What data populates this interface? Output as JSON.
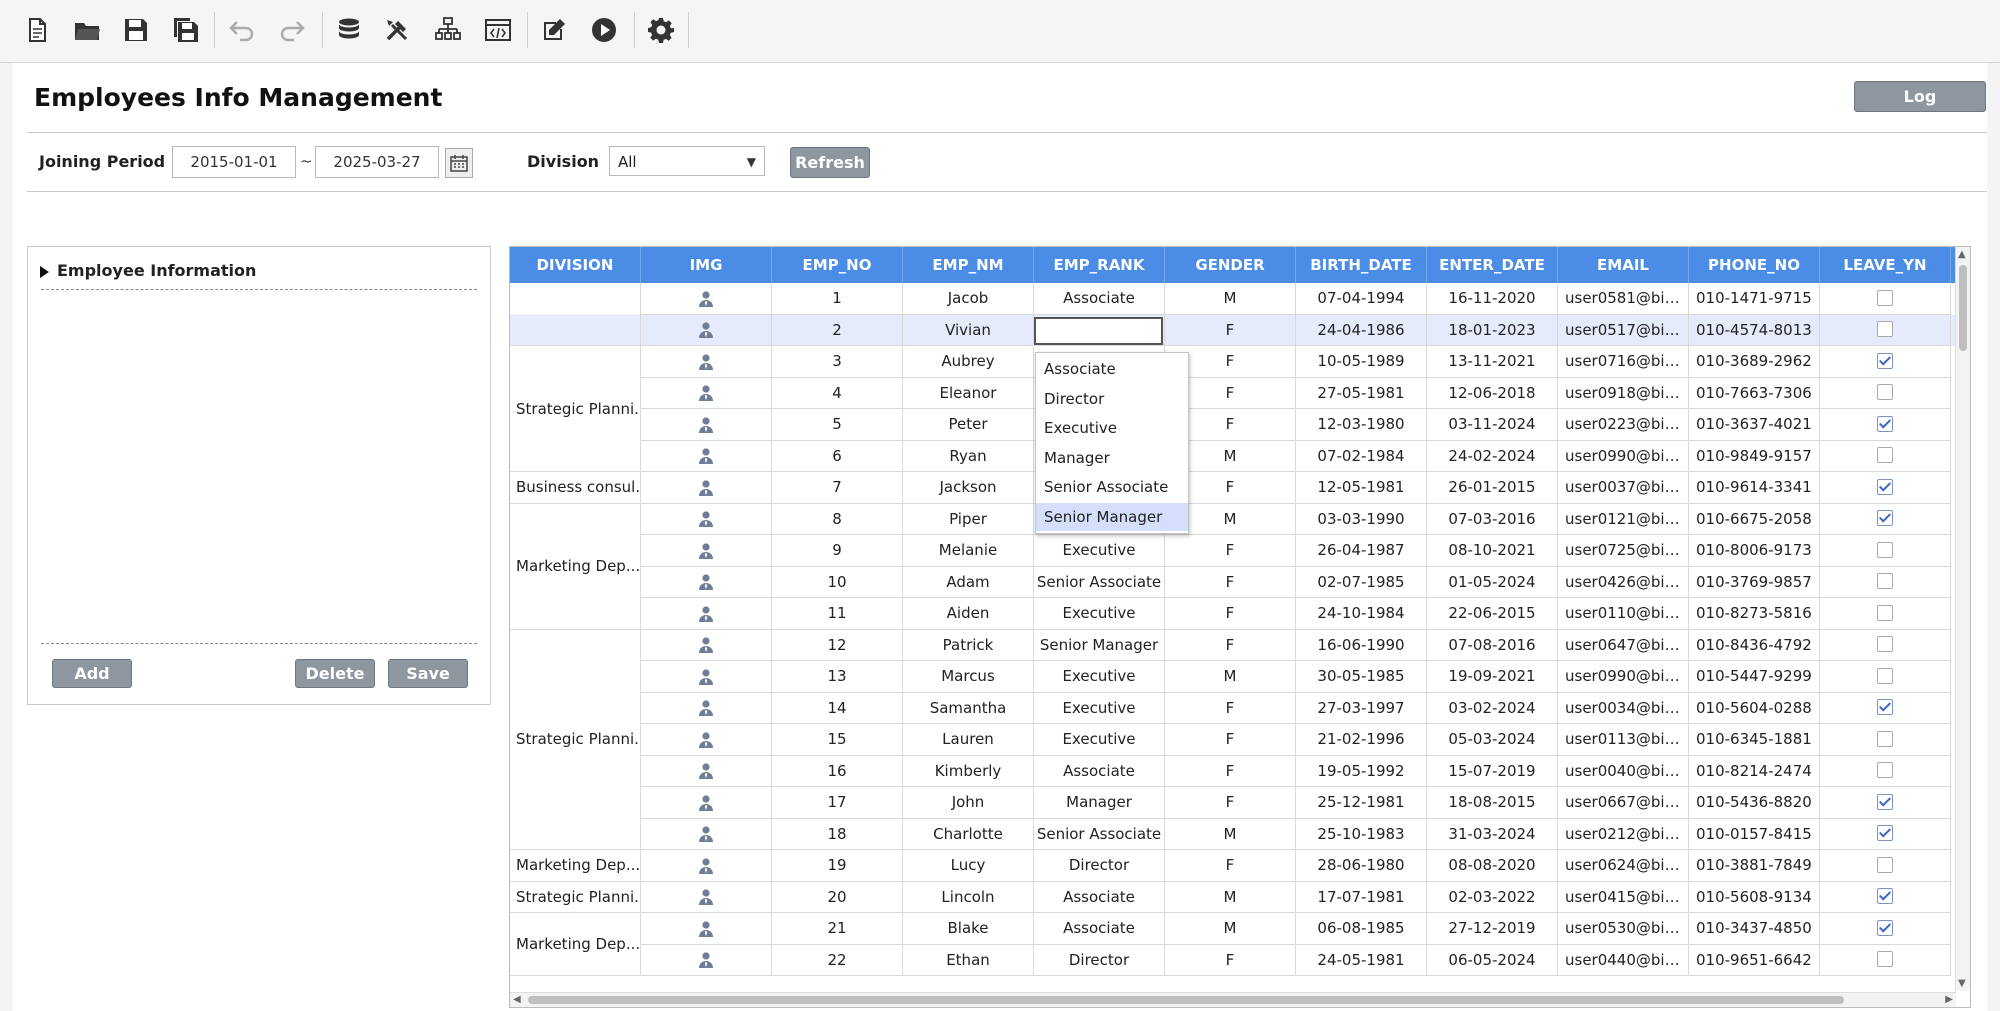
{
  "toolbar": {
    "buttons": [
      "new-file",
      "open-folder",
      "save",
      "save-all",
      "undo",
      "redo",
      "database",
      "tools",
      "hierarchy",
      "code-view",
      "edit",
      "run",
      "settings"
    ]
  },
  "page": {
    "title": "Employees Info Management",
    "log_label": "Log"
  },
  "filter": {
    "joining_period_label": "Joining Period",
    "date_from": "2015-01-01",
    "tilde": "~",
    "date_to": "2025-03-27",
    "division_label": "Division",
    "division_value": "All",
    "refresh_label": "Refresh"
  },
  "left_panel": {
    "title": "Employee Information",
    "add_label": "Add",
    "delete_label": "Delete",
    "save_label": "Save"
  },
  "grid": {
    "columns": [
      "DIVISION",
      "IMG",
      "EMP_NO",
      "EMP_NM",
      "EMP_RANK",
      "GENDER",
      "BIRTH_DATE",
      "ENTER_DATE",
      "EMAIL",
      "PHONE_NO",
      "LEAVE_YN"
    ],
    "division_groups": [
      {
        "label": "",
        "rows": 2
      },
      {
        "label": "Strategic Planni...",
        "rows": 4
      },
      {
        "label": "Business consul...",
        "rows": 1
      },
      {
        "label": "Marketing Dep...",
        "rows": 4
      },
      {
        "label": "Strategic Planni...",
        "rows": 7
      },
      {
        "label": "Marketing Dep...",
        "rows": 1
      },
      {
        "label": "Strategic Planni...",
        "rows": 1
      },
      {
        "label": "Marketing Dep...",
        "rows": 2
      }
    ],
    "selected_row": 1,
    "rows": [
      {
        "no": "1",
        "name": "Jacob",
        "rank": "Associate",
        "gender": "M",
        "birth": "07-04-1994",
        "enter": "16-11-2020",
        "email": "user0581@bim...",
        "phone": "010-1471-9715",
        "leave": false
      },
      {
        "no": "2",
        "name": "Vivian",
        "rank": "",
        "gender": "F",
        "birth": "24-04-1986",
        "enter": "18-01-2023",
        "email": "user0517@bim...",
        "phone": "010-4574-8013",
        "leave": false
      },
      {
        "no": "3",
        "name": "Aubrey",
        "rank": "",
        "gender": "F",
        "birth": "10-05-1989",
        "enter": "13-11-2021",
        "email": "user0716@bim...",
        "phone": "010-3689-2962",
        "leave": true
      },
      {
        "no": "4",
        "name": "Eleanor",
        "rank": "",
        "gender": "F",
        "birth": "27-05-1981",
        "enter": "12-06-2018",
        "email": "user0918@bim...",
        "phone": "010-7663-7306",
        "leave": false
      },
      {
        "no": "5",
        "name": "Peter",
        "rank": "",
        "gender": "F",
        "birth": "12-03-1980",
        "enter": "03-11-2024",
        "email": "user0223@bim...",
        "phone": "010-3637-4021",
        "leave": true
      },
      {
        "no": "6",
        "name": "Ryan",
        "rank": "",
        "gender": "M",
        "birth": "07-02-1984",
        "enter": "24-02-2024",
        "email": "user0990@bim...",
        "phone": "010-9849-9157",
        "leave": false
      },
      {
        "no": "7",
        "name": "Jackson",
        "rank": "",
        "gender": "F",
        "birth": "12-05-1981",
        "enter": "26-01-2015",
        "email": "user0037@bim...",
        "phone": "010-9614-3341",
        "leave": true
      },
      {
        "no": "8",
        "name": "Piper",
        "rank": "",
        "gender": "M",
        "birth": "03-03-1990",
        "enter": "07-03-2016",
        "email": "user0121@bim...",
        "phone": "010-6675-2058",
        "leave": true
      },
      {
        "no": "9",
        "name": "Melanie",
        "rank": "Executive",
        "gender": "F",
        "birth": "26-04-1987",
        "enter": "08-10-2021",
        "email": "user0725@bim...",
        "phone": "010-8006-9173",
        "leave": false
      },
      {
        "no": "10",
        "name": "Adam",
        "rank": "Senior Associate",
        "gender": "F",
        "birth": "02-07-1985",
        "enter": "01-05-2024",
        "email": "user0426@bim...",
        "phone": "010-3769-9857",
        "leave": false
      },
      {
        "no": "11",
        "name": "Aiden",
        "rank": "Executive",
        "gender": "F",
        "birth": "24-10-1984",
        "enter": "22-06-2015",
        "email": "user0110@bim...",
        "phone": "010-8273-5816",
        "leave": false
      },
      {
        "no": "12",
        "name": "Patrick",
        "rank": "Senior Manager",
        "gender": "F",
        "birth": "16-06-1990",
        "enter": "07-08-2016",
        "email": "user0647@bim...",
        "phone": "010-8436-4792",
        "leave": false
      },
      {
        "no": "13",
        "name": "Marcus",
        "rank": "Executive",
        "gender": "M",
        "birth": "30-05-1985",
        "enter": "19-09-2021",
        "email": "user0990@bim...",
        "phone": "010-5447-9299",
        "leave": false
      },
      {
        "no": "14",
        "name": "Samantha",
        "rank": "Executive",
        "gender": "F",
        "birth": "27-03-1997",
        "enter": "03-02-2024",
        "email": "user0034@bim...",
        "phone": "010-5604-0288",
        "leave": true
      },
      {
        "no": "15",
        "name": "Lauren",
        "rank": "Executive",
        "gender": "F",
        "birth": "21-02-1996",
        "enter": "05-03-2024",
        "email": "user0113@bim...",
        "phone": "010-6345-1881",
        "leave": false
      },
      {
        "no": "16",
        "name": "Kimberly",
        "rank": "Associate",
        "gender": "F",
        "birth": "19-05-1992",
        "enter": "15-07-2019",
        "email": "user0040@bim...",
        "phone": "010-8214-2474",
        "leave": false
      },
      {
        "no": "17",
        "name": "John",
        "rank": "Manager",
        "gender": "F",
        "birth": "25-12-1981",
        "enter": "18-08-2015",
        "email": "user0667@bim...",
        "phone": "010-5436-8820",
        "leave": true
      },
      {
        "no": "18",
        "name": "Charlotte",
        "rank": "Senior Associate",
        "gender": "M",
        "birth": "25-10-1983",
        "enter": "31-03-2024",
        "email": "user0212@bim...",
        "phone": "010-0157-8415",
        "leave": true
      },
      {
        "no": "19",
        "name": "Lucy",
        "rank": "Director",
        "gender": "F",
        "birth": "28-06-1980",
        "enter": "08-08-2020",
        "email": "user0624@bim...",
        "phone": "010-3881-7849",
        "leave": false
      },
      {
        "no": "20",
        "name": "Lincoln",
        "rank": "Associate",
        "gender": "M",
        "birth": "17-07-1981",
        "enter": "02-03-2022",
        "email": "user0415@bim...",
        "phone": "010-5608-9134",
        "leave": true
      },
      {
        "no": "21",
        "name": "Blake",
        "rank": "Associate",
        "gender": "M",
        "birth": "06-08-1985",
        "enter": "27-12-2019",
        "email": "user0530@bim...",
        "phone": "010-3437-4850",
        "leave": true
      },
      {
        "no": "22",
        "name": "Ethan",
        "rank": "Director",
        "gender": "F",
        "birth": "24-05-1981",
        "enter": "06-05-2024",
        "email": "user0440@bim...",
        "phone": "010-9651-6642",
        "leave": false
      }
    ]
  },
  "rank_dropdown": {
    "options": [
      "Associate",
      "Director",
      "Executive",
      "Manager",
      "Senior Associate",
      "Senior Manager"
    ],
    "highlighted": 5
  },
  "colors": {
    "header": "#4a8ce6",
    "button": "#8e96a0",
    "selected_row": "#e6ebfb"
  }
}
